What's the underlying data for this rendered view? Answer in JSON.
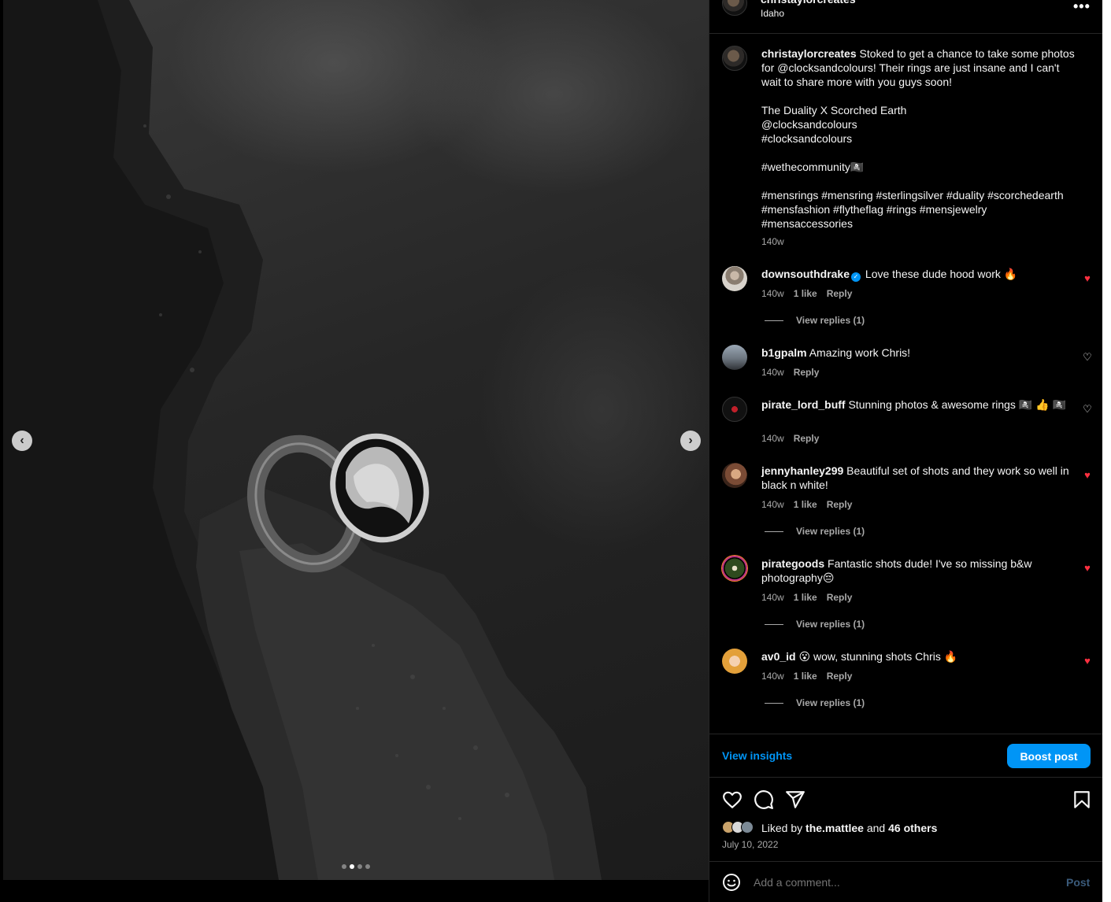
{
  "header": {
    "username": "christaylorcreates",
    "location": "Idaho",
    "more_icon": "more-horizontal-icon"
  },
  "media": {
    "slide_count": 4,
    "active_slide": 2,
    "prev_icon": "chevron-left-icon",
    "next_icon": "chevron-right-icon",
    "prev_label": "‹",
    "next_label": "›"
  },
  "caption": {
    "username": "christaylorcreates",
    "lines": [
      "Stoked to get a chance to take some photos for @clocksandcolours! Their rings are just insane and I can't wait to share more with you guys soon!",
      "",
      "The Duality X Scorched Earth",
      "@clocksandcolours",
      "#clocksandcolours",
      "",
      "#wethecommunity🏴‍☠️",
      "",
      "#mensrings #mensring #sterlingsilver #duality #scorchedearth #mensfashion #flytheflag #rings #mensjewelry #mensaccessories"
    ],
    "time": "140w"
  },
  "comments": [
    {
      "username": "downsouthdrake",
      "verified": true,
      "text": "Love these dude hood work 🔥",
      "time": "140w",
      "likes": "1 like",
      "reply": "Reply",
      "liked": true,
      "view_replies": "View replies (1)"
    },
    {
      "username": "b1gpalm",
      "verified": false,
      "text": "Amazing work Chris!",
      "time": "140w",
      "likes": "",
      "reply": "Reply",
      "liked": false,
      "view_replies": ""
    },
    {
      "username": "pirate_lord_buff",
      "verified": false,
      "text": "Stunning photos & awesome rings 🏴‍☠️ 👍 🏴‍☠️",
      "time": "140w",
      "likes": "",
      "reply": "Reply",
      "liked": false,
      "view_replies": ""
    },
    {
      "username": "jennyhanley299",
      "verified": false,
      "text": "Beautiful set of shots and they work so well in black n white!",
      "time": "140w",
      "likes": "1 like",
      "reply": "Reply",
      "liked": true,
      "view_replies": "View replies (1)"
    },
    {
      "username": "pirategoods",
      "verified": false,
      "text": "Fantastic shots dude! I've so missing b&w photography😔",
      "time": "140w",
      "likes": "1 like",
      "reply": "Reply",
      "liked": true,
      "view_replies": "View replies (1)"
    },
    {
      "username": "av0_id",
      "verified": false,
      "text": "😮 wow, stunning shots Chris 🔥",
      "time": "140w",
      "likes": "1 like",
      "reply": "Reply",
      "liked": true,
      "view_replies": "View replies (1)"
    }
  ],
  "insights": {
    "view_insights": "View insights",
    "boost_post": "Boost post"
  },
  "actions": {
    "like_icon": "heart-outline-icon",
    "comment_icon": "comment-bubble-icon",
    "share_icon": "paper-plane-icon",
    "save_icon": "bookmark-icon"
  },
  "likes": {
    "prefix": "Liked by",
    "user": "the.mattlee",
    "and": "and",
    "others": "46 others"
  },
  "date": "July 10, 2022",
  "add_comment": {
    "placeholder": "Add a comment...",
    "post": "Post",
    "emoji_icon": "smiley-icon"
  },
  "colors": {
    "accent": "#0095f6",
    "liked_heart": "#ff3040",
    "secondary_text": "#a8a8a8",
    "background": "#000000"
  }
}
